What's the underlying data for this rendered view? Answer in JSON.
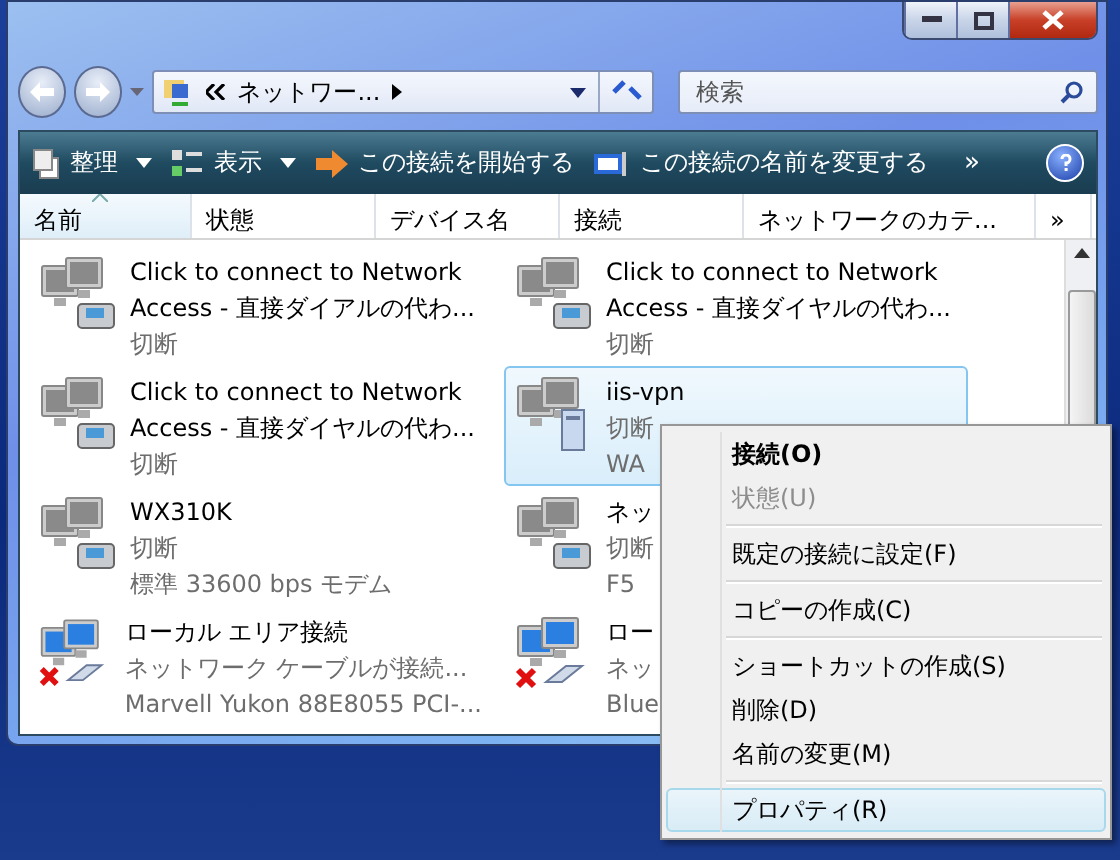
{
  "address": {
    "path": "ネットワー...",
    "search_placeholder": "検索"
  },
  "toolbar": [
    {
      "kind": "organize",
      "label": "整理",
      "dropdown": true
    },
    {
      "kind": "view",
      "label": "表示",
      "dropdown": true
    },
    {
      "kind": "start",
      "label": "この接続を開始する",
      "dropdown": false
    },
    {
      "kind": "rename",
      "label": "この接続の名前を変更する",
      "dropdown": false
    }
  ],
  "toolbar_more": "»",
  "columns": [
    {
      "label": "名前",
      "sorted": true
    },
    {
      "label": "状態",
      "sorted": false
    },
    {
      "label": "デバイス名",
      "sorted": false
    },
    {
      "label": "接続",
      "sorted": false
    },
    {
      "label": "ネットワークのカテ...",
      "sorted": false
    }
  ],
  "columns_more": "»",
  "connections": [
    {
      "kind": "dialup",
      "lines": [
        "Click to connect to Network",
        "Access - 直接ダイアルの代わ...",
        "切断"
      ],
      "selected": false
    },
    {
      "kind": "dialup",
      "lines": [
        "Click to connect to Network",
        "Access - 直接ダイヤルの代わ...",
        "切断"
      ],
      "selected": false
    },
    {
      "kind": "dialup",
      "lines": [
        "Click to connect to Network",
        "Access - 直接ダイヤルの代わ...",
        "切断"
      ],
      "selected": false
    },
    {
      "kind": "vpn",
      "lines": [
        "iis-vpn",
        "切断",
        "WA"
      ],
      "selected": true
    },
    {
      "kind": "dialup",
      "lines": [
        "WX310K",
        "切断",
        "標準 33600 bps モデム"
      ],
      "selected": false
    },
    {
      "kind": "dialup",
      "lines": [
        "ネッ",
        "切断",
        "F5"
      ],
      "selected": false
    },
    {
      "kind": "lan",
      "lines": [
        "ローカル エリア接続",
        "ネットワーク ケーブルが接続...",
        "Marvell Yukon 88E8055 PCI-..."
      ],
      "selected": false
    },
    {
      "kind": "lan",
      "lines": [
        "ロー",
        "ネッ",
        "Blue"
      ],
      "selected": false
    }
  ],
  "context_menu": [
    [
      {
        "label": "接続(O)",
        "default": true,
        "disabled": false,
        "selected": false
      },
      {
        "label": "状態(U)",
        "default": false,
        "disabled": true,
        "selected": false
      }
    ],
    [
      {
        "label": "既定の接続に設定(F)",
        "default": false,
        "disabled": false,
        "selected": false
      }
    ],
    [
      {
        "label": "コピーの作成(C)",
        "default": false,
        "disabled": false,
        "selected": false
      }
    ],
    [
      {
        "label": "ショートカットの作成(S)",
        "default": false,
        "disabled": false,
        "selected": false
      },
      {
        "label": "削除(D)",
        "default": false,
        "disabled": false,
        "selected": false
      },
      {
        "label": "名前の変更(M)",
        "default": false,
        "disabled": false,
        "selected": false
      }
    ],
    [
      {
        "label": "プロパティ(R)",
        "default": false,
        "disabled": false,
        "selected": true
      }
    ]
  ]
}
